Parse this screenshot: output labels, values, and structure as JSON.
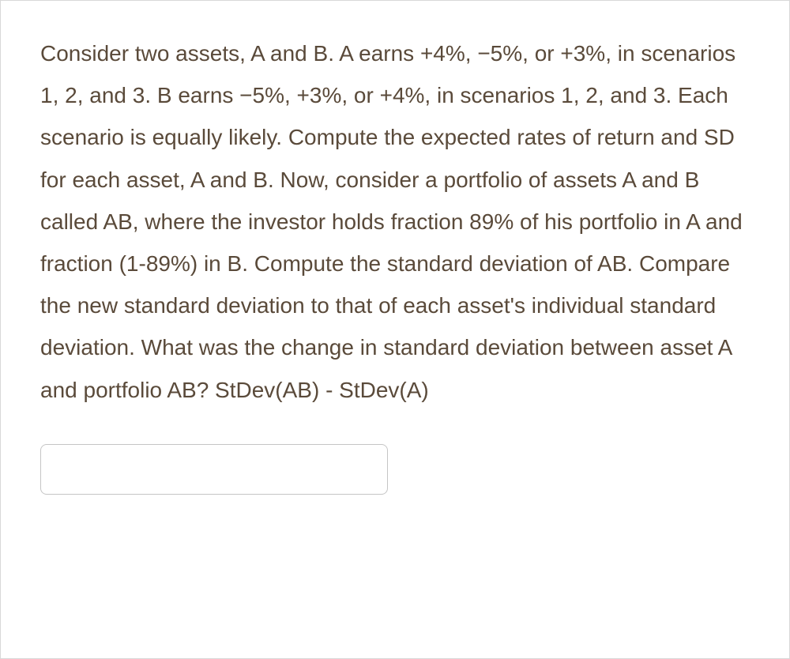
{
  "question": {
    "text": "Consider two assets, A and B. A earns +4%, −5%, or +3%, in scenarios 1, 2, and 3. B earns −5%, +3%, or +4%, in scenarios 1, 2, and 3. Each scenario is equally likely. Compute the expected rates of return and SD for each asset, A and B. Now, consider a portfolio of assets A and B called AB, where the investor holds fraction 89% of his portfolio in A and fraction (1-89%) in B. Compute the standard deviation of AB. Compare the new standard deviation to that of each asset's individual standard deviation. What was the change in standard deviation between asset A and portfolio AB? StDev(AB) - StDev(A)"
  },
  "answer": {
    "value": "",
    "placeholder": ""
  }
}
